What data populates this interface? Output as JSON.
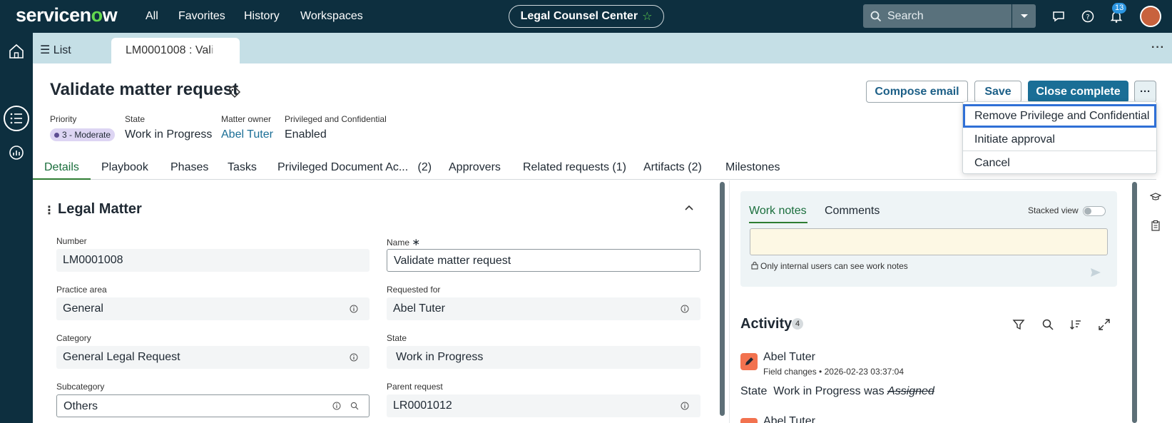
{
  "topnav": {
    "logo_text": "servicenow",
    "links": [
      "All",
      "Favorites",
      "History",
      "Workspaces"
    ],
    "workspace_title": "Legal Counsel Center",
    "search_placeholder": "Search",
    "notification_count": "13",
    "icons": [
      "chat-icon",
      "help-icon",
      "bell-icon",
      "avatar"
    ]
  },
  "rail": {
    "icons": [
      "home-icon",
      "list-icon",
      "analytics-icon"
    ]
  },
  "tabbar": {
    "list_label": "List",
    "record_tab": "LM0001008 : Val",
    "record_tab_fade": "i"
  },
  "header": {
    "title": "Validate matter request",
    "buttons": {
      "compose": "Compose email",
      "save": "Save",
      "close_complete": "Close complete",
      "more": "···"
    },
    "meta": [
      {
        "label": "Priority",
        "value": "3 - Moderate"
      },
      {
        "label": "State",
        "value": "Work in Progress"
      },
      {
        "label": "Matter owner",
        "value": "Abel Tuter"
      },
      {
        "label": "Privileged and Confidential",
        "value": "Enabled"
      }
    ]
  },
  "menu": {
    "items": [
      "Remove Privilege and Confidential",
      "Initiate approval",
      "Cancel"
    ]
  },
  "tabs": [
    "Details",
    "Playbook",
    "Phases",
    "Tasks",
    "Privileged Document Ac...   (2)",
    "Approvers",
    "Related requests (1)",
    "Artifacts (2)",
    "Milestones"
  ],
  "form": {
    "section_title": "Legal Matter",
    "fields": {
      "number": {
        "label": "Number",
        "value": "LM0001008"
      },
      "name": {
        "label": "Name",
        "value": "Validate matter request"
      },
      "practice_area": {
        "label": "Practice area",
        "value": "General"
      },
      "requested_for": {
        "label": "Requested for",
        "value": "Abel Tuter"
      },
      "category": {
        "label": "Category",
        "value": "General Legal Request"
      },
      "state": {
        "label": "State",
        "value": "Work in Progress"
      },
      "subcategory": {
        "label": "Subcategory",
        "value": "Others"
      },
      "parent_request": {
        "label": "Parent request",
        "value": "LR0001012"
      }
    }
  },
  "notes": {
    "tab_work_notes": "Work notes",
    "tab_comments": "Comments",
    "stacked_view": "Stacked view",
    "hint": "Only internal users can see work notes"
  },
  "activity": {
    "title": "Activity",
    "count": "4",
    "entries": [
      {
        "author": "Abel Tuter",
        "type": "Field changes",
        "timestamp": "2026-02-23 03:37:04",
        "field": "State",
        "new_value": "Work in Progress",
        "was": "was",
        "old_value": "Assigned"
      },
      {
        "author": "Abel Tuter"
      }
    ]
  },
  "colors": {
    "nav_bg": "#0d2f3f",
    "tabbar_bg": "#c5dfe6",
    "primary": "#1a6e96",
    "active_tab": "#2e7d32",
    "focus_ring": "#2f6fd6"
  }
}
